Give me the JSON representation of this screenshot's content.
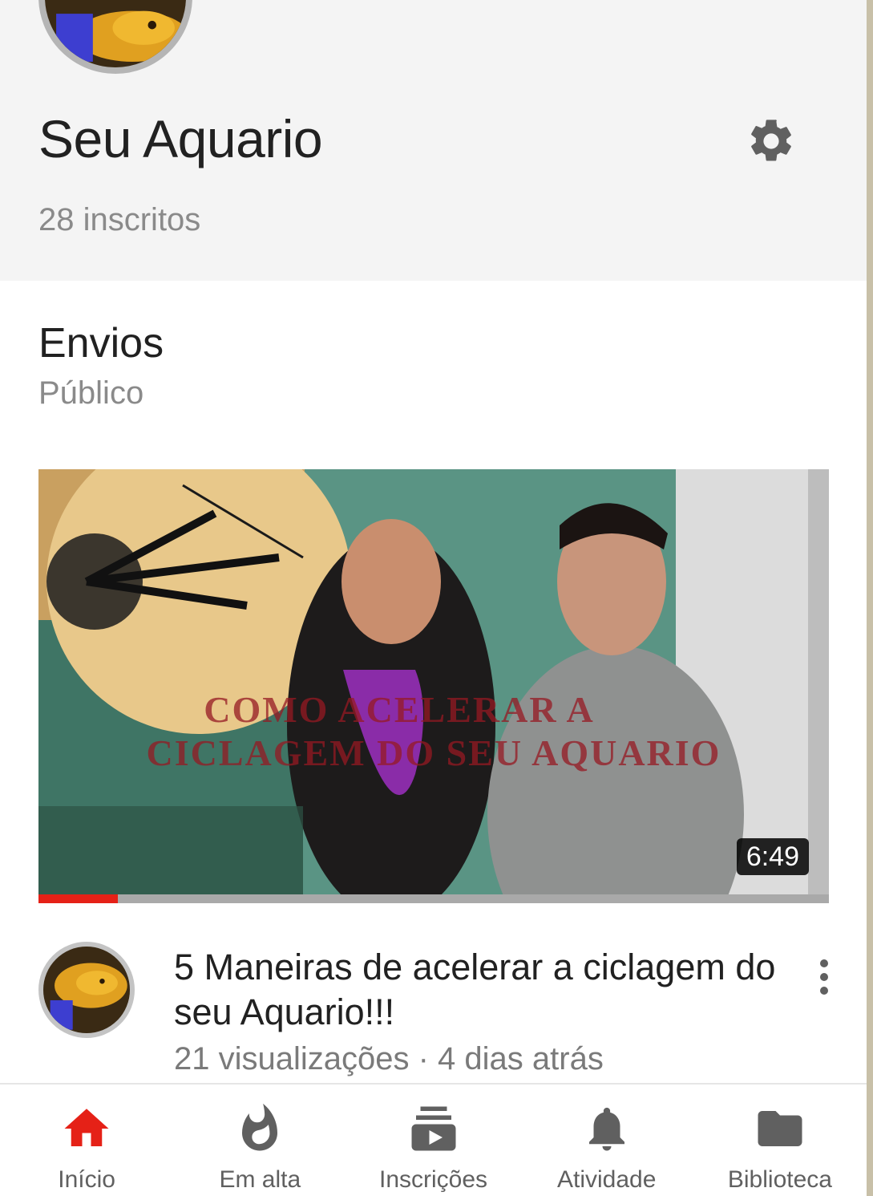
{
  "channel": {
    "name": "Seu Aquario",
    "subscribers": "28 inscritos"
  },
  "uploads": {
    "title": "Envios",
    "visibility": "Público"
  },
  "video": {
    "thumbnail_text_line1": "COMO ACELERAR A",
    "thumbnail_text_line2": "CICLAGEM DO SEU AQUARIO",
    "duration": "6:49",
    "watch_progress": 0.1,
    "title": "5 Maneiras de acelerar a ciclagem do seu Aquario!!!",
    "stats": "21 visualizações · 4 dias atrás"
  },
  "bottom_nav": {
    "items": [
      {
        "label": "Início",
        "icon": "home-icon",
        "active": true
      },
      {
        "label": "Em alta",
        "icon": "flame-icon",
        "active": false
      },
      {
        "label": "Inscrições",
        "icon": "subscriptions-icon",
        "active": false
      },
      {
        "label": "Atividade",
        "icon": "bell-icon",
        "active": false
      },
      {
        "label": "Biblioteca",
        "icon": "folder-icon",
        "active": false
      }
    ]
  },
  "colors": {
    "accent": "#e52117",
    "header_bg": "#f4f4f4",
    "secondary_text": "#8a8a8a",
    "icon_gray": "#606060"
  }
}
